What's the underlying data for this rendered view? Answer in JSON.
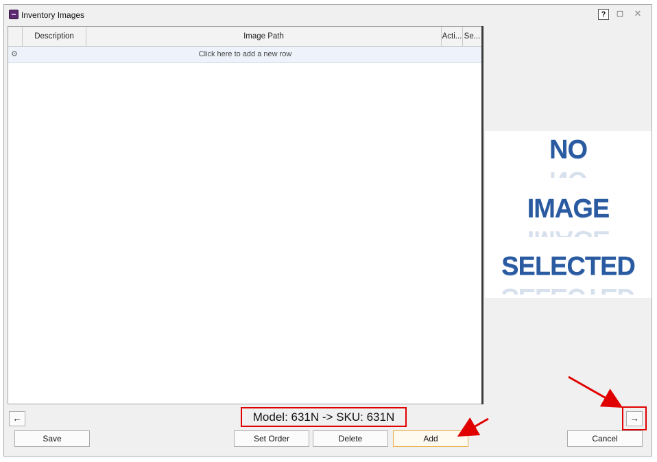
{
  "window": {
    "title": "Inventory Images",
    "help_label": "?",
    "restore_label": "▢",
    "close_label": "✕"
  },
  "grid": {
    "columns": [
      "Description",
      "Image Path",
      "Acti...",
      "Se..."
    ],
    "new_row_text": "Click here to add a new row"
  },
  "preview": {
    "lines": [
      "NO",
      "IMAGE",
      "SELECTED"
    ]
  },
  "nav": {
    "prev_label": "←",
    "next_label": "→"
  },
  "model_label": "Model: 631N -> SKU: 631N",
  "buttons": {
    "save": "Save",
    "set_order": "Set Order",
    "delete": "Delete",
    "add": "Add",
    "cancel": "Cancel"
  },
  "colors": {
    "highlight": "#e00000",
    "no_image_text": "#2a5aa0",
    "add_border": "#e8b04a"
  }
}
